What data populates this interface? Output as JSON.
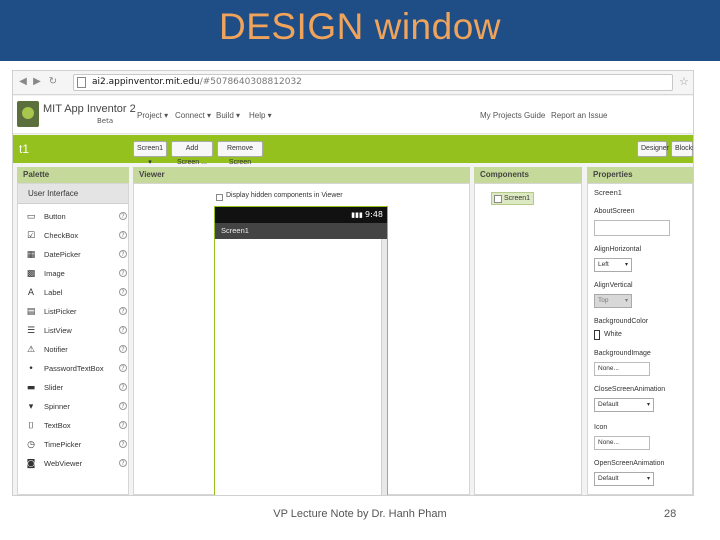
{
  "slide": {
    "title": "DESIGN window",
    "footer": "VP Lecture Note by Dr. Hanh Pham",
    "page_number": "28"
  },
  "browser": {
    "url_host": "ai2.appinventor.mit.edu",
    "url_rest": "/#5078640308812032"
  },
  "app": {
    "name": "MIT App Inventor 2",
    "edition": "Beta",
    "menus": [
      "Project ▾",
      "Connect ▾",
      "Build ▾",
      "Help ▾"
    ],
    "right_links": [
      "My Projects",
      "Guide",
      "Report an Issue"
    ]
  },
  "toolbar": {
    "project_name": "t1",
    "screen_select": "Screen1 ▾",
    "add_screen": "Add Screen ...",
    "remove_screen": "Remove Screen",
    "designer": "Designer",
    "blocks": "Blocks"
  },
  "panels": {
    "palette": "Palette",
    "viewer": "Viewer",
    "components": "Components",
    "properties": "Properties"
  },
  "palette": {
    "category": "User Interface",
    "items": [
      {
        "label": "Button",
        "icon": "button-icon"
      },
      {
        "label": "CheckBox",
        "icon": "checkbox-icon"
      },
      {
        "label": "DatePicker",
        "icon": "datepicker-icon"
      },
      {
        "label": "Image",
        "icon": "image-icon"
      },
      {
        "label": "Label",
        "icon": "label-icon"
      },
      {
        "label": "ListPicker",
        "icon": "listpicker-icon"
      },
      {
        "label": "ListView",
        "icon": "listview-icon"
      },
      {
        "label": "Notifier",
        "icon": "notifier-icon"
      },
      {
        "label": "PasswordTextBox",
        "icon": "password-icon"
      },
      {
        "label": "Slider",
        "icon": "slider-icon"
      },
      {
        "label": "Spinner",
        "icon": "spinner-icon"
      },
      {
        "label": "TextBox",
        "icon": "textbox-icon"
      },
      {
        "label": "TimePicker",
        "icon": "timepicker-icon"
      },
      {
        "label": "WebViewer",
        "icon": "webviewer-icon"
      }
    ]
  },
  "viewer": {
    "hidden_checkbox_label": "Display hidden components in Viewer",
    "status_time": "9:48",
    "screen_title": "Screen1"
  },
  "components": {
    "root": "Screen1"
  },
  "properties": {
    "component": "Screen1",
    "fields": [
      {
        "label": "AboutScreen",
        "kind": "textarea",
        "value": ""
      },
      {
        "label": "AlignHorizontal",
        "kind": "select",
        "value": "Left"
      },
      {
        "label": "AlignVertical",
        "kind": "select-disabled",
        "value": "Top"
      },
      {
        "label": "BackgroundColor",
        "kind": "color",
        "value": "White"
      },
      {
        "label": "BackgroundImage",
        "kind": "input",
        "value": "None..."
      },
      {
        "label": "CloseScreenAnimation",
        "kind": "select",
        "value": "Default"
      },
      {
        "label": "Icon",
        "kind": "input",
        "value": "None..."
      },
      {
        "label": "OpenScreenAnimation",
        "kind": "select",
        "value": "Default"
      }
    ]
  }
}
